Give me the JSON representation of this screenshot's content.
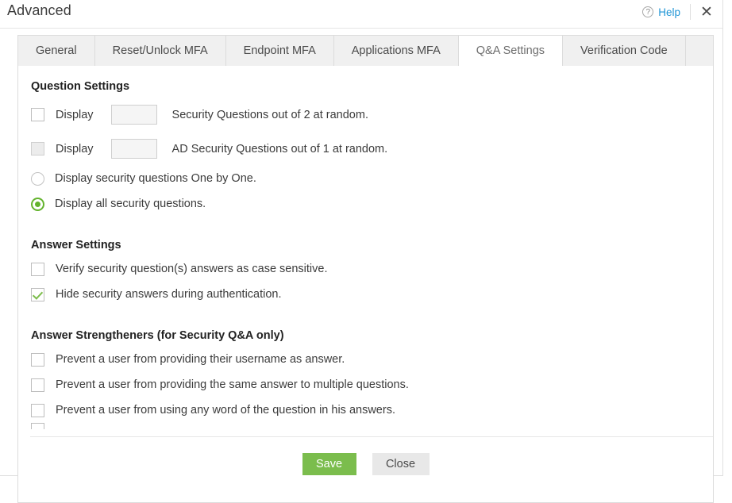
{
  "window": {
    "title": "Advanced",
    "help_label": "Help",
    "help_icon": "question-circle-icon",
    "close_icon": "close-icon",
    "close_glyph": "✕"
  },
  "tabs": [
    {
      "label": "General",
      "active": false
    },
    {
      "label": "Reset/Unlock MFA",
      "active": false
    },
    {
      "label": "Endpoint MFA",
      "active": false
    },
    {
      "label": "Applications MFA",
      "active": false
    },
    {
      "label": "Q&A Settings",
      "active": true
    },
    {
      "label": "Verification Code",
      "active": false
    }
  ],
  "sections": {
    "question_settings": {
      "title": "Question Settings",
      "rows": [
        {
          "prefix": "Display",
          "value": "",
          "placeholder": "",
          "suffix": "Security Questions out of 2 at random.",
          "checked": false,
          "disabled": false
        },
        {
          "prefix": "Display",
          "value": "",
          "placeholder": "",
          "suffix": "AD Security Questions out of 1 at random.",
          "checked": false,
          "disabled": true
        }
      ],
      "radios": [
        {
          "label": "Display security questions One by One.",
          "selected": false
        },
        {
          "label": "Display all security questions.",
          "selected": true
        }
      ]
    },
    "answer_settings": {
      "title": "Answer Settings",
      "items": [
        {
          "label": "Verify security question(s) answers as case sensitive.",
          "checked": false
        },
        {
          "label": "Hide security answers during authentication.",
          "checked": true
        }
      ]
    },
    "answer_strengtheners": {
      "title": "Answer Strengtheners (for Security Q&A only)",
      "items": [
        {
          "label": "Prevent a user from providing their username as answer.",
          "checked": false
        },
        {
          "label": "Prevent a user from providing the same answer to multiple questions.",
          "checked": false
        },
        {
          "label": "Prevent a user from using any word of the question in his answers.",
          "checked": false
        }
      ]
    }
  },
  "footer": {
    "save_label": "Save",
    "close_label": "Close"
  },
  "colors": {
    "accent_green": "#7bbd4d",
    "radio_green": "#63b32d",
    "link_blue": "#2196d6",
    "tab_inactive_bg": "#f0f0f0",
    "border": "#dcdcdc"
  }
}
